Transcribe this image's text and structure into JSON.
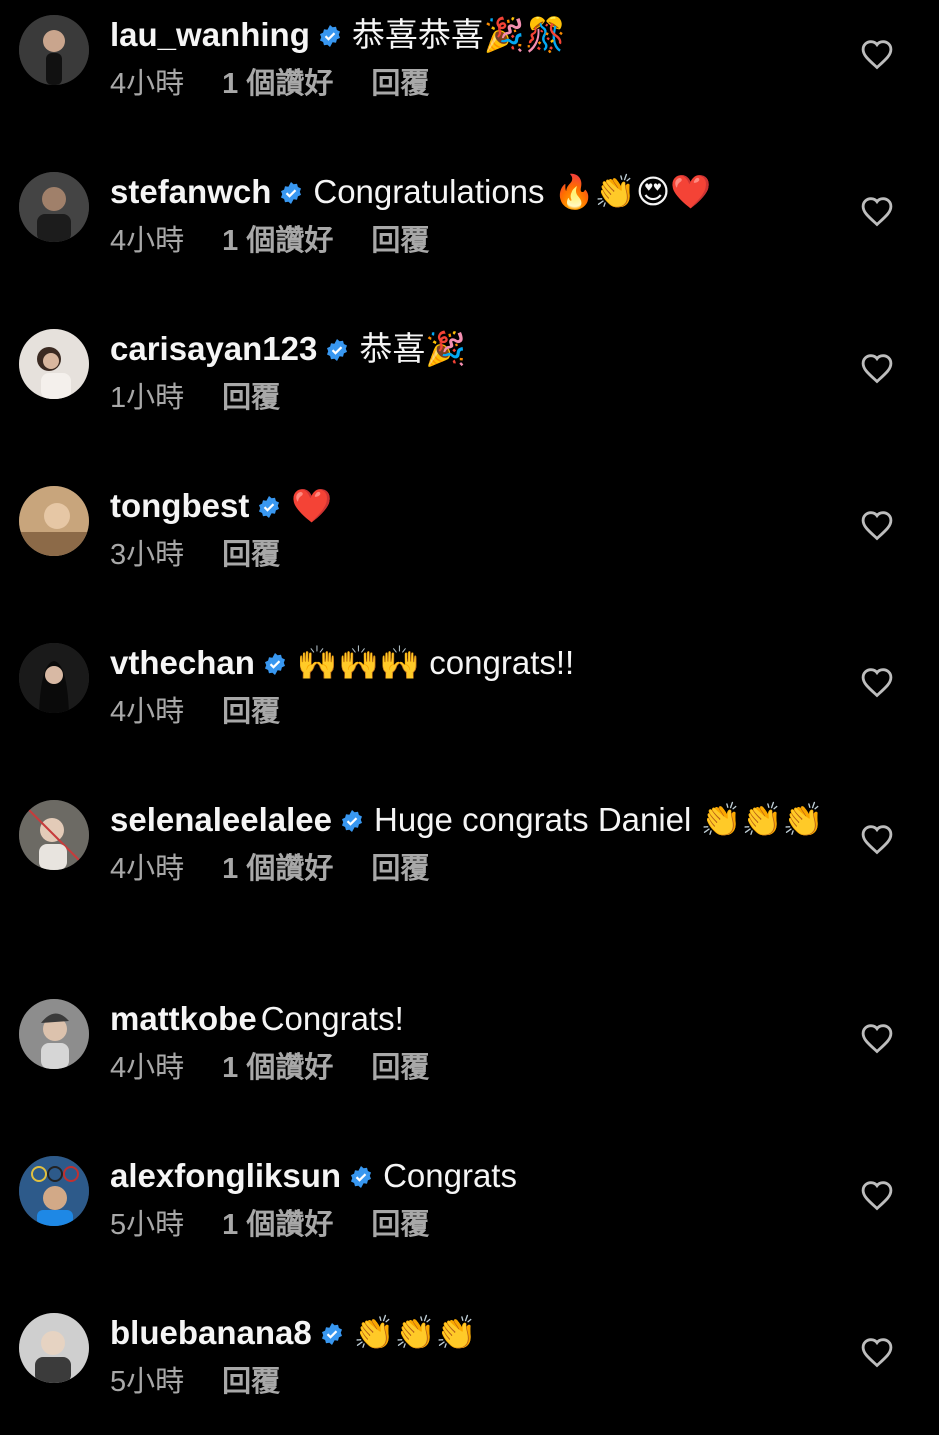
{
  "colors": {
    "background": "#000000",
    "text": "#f5f5f5",
    "secondary": "#a8a8a8",
    "verified": "#3897f0"
  },
  "icons": {
    "verified": "verified-badge-icon",
    "like": "heart-outline-icon"
  },
  "comments": [
    {
      "username": "lau_wanhing",
      "verified": true,
      "text": "恭喜恭喜🎉🎊",
      "time": "4小時",
      "likes": "1 個讚好",
      "reply": "回覆"
    },
    {
      "username": "stefanwch",
      "verified": true,
      "text": "Congratulations 🔥👏😍❤️",
      "time": "4小時",
      "likes": "1 個讚好",
      "reply": "回覆"
    },
    {
      "username": "carisayan123",
      "verified": true,
      "text": "恭喜🎉",
      "time": "1小時",
      "likes": "",
      "reply": "回覆"
    },
    {
      "username": "tongbest",
      "verified": true,
      "text": "❤️",
      "time": "3小時",
      "likes": "",
      "reply": "回覆"
    },
    {
      "username": "vthechan",
      "verified": true,
      "text": "🙌🙌🙌 congrats!!",
      "time": "4小時",
      "likes": "",
      "reply": "回覆"
    },
    {
      "username": "selenaleelalee",
      "verified": true,
      "text": "Huge congrats Daniel 👏👏👏",
      "time": "4小時",
      "likes": "1 個讚好",
      "reply": "回覆"
    },
    {
      "username": "mattkobe",
      "verified": false,
      "text": "Congrats!",
      "time": "4小時",
      "likes": "1 個讚好",
      "reply": "回覆"
    },
    {
      "username": "alexfongliksun",
      "verified": true,
      "text": "Congrats",
      "time": "5小時",
      "likes": "1 個讚好",
      "reply": "回覆"
    },
    {
      "username": "bluebanana8",
      "verified": true,
      "text": "👏👏👏",
      "time": "5小時",
      "likes": "",
      "reply": "回覆"
    }
  ]
}
